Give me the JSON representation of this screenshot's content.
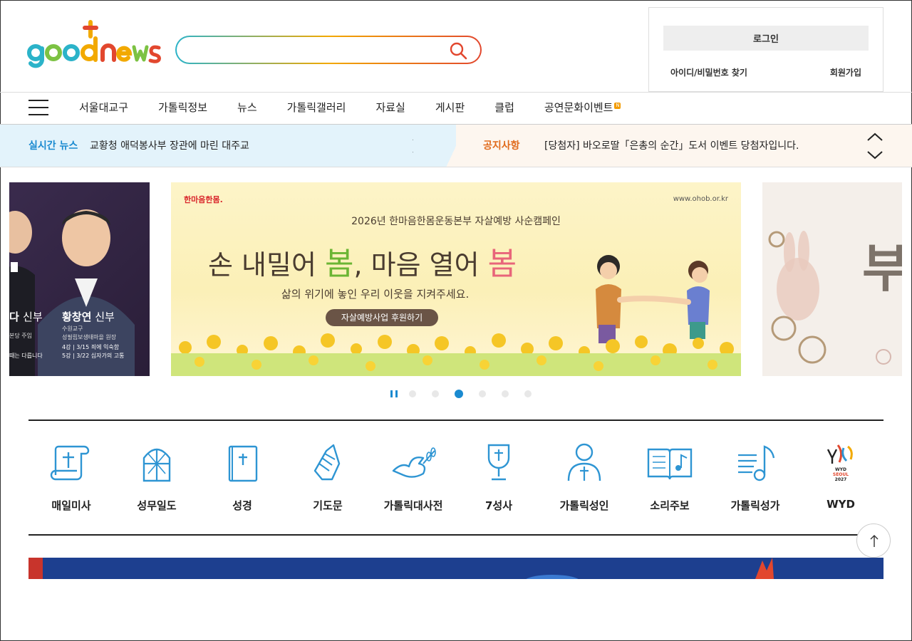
{
  "search": {
    "placeholder": ""
  },
  "account": {
    "login_label": "로그인",
    "find_label": "아이디/비밀번호 찾기",
    "join_label": "회원가입"
  },
  "nav": {
    "items": [
      "서울대교구",
      "가톨릭정보",
      "뉴스",
      "가톨릭갤러리",
      "자료실",
      "게시판",
      "클럽",
      "공연문화이벤트"
    ],
    "new_badge": "N"
  },
  "ticker": {
    "news_label": "실시간 뉴스",
    "news_text": "교황청 애덕봉사부 장관에 마린 대주교",
    "notice_label": "공지사항",
    "notice_text": "[당첨자] 바오로딸「은총의 순간」도서 이벤트 당첨자입니다."
  },
  "slides": {
    "left": {
      "name": "황창연",
      "title": "신부",
      "partial_name": "다",
      "desc1": "수원교구",
      "desc2": "성필립보생태마을 원장",
      "left_desc": "본당 주임",
      "lecture1": "4강 | 3/15  죄에 익숙함",
      "lecture2": "5강 | 3/22  십자가의 고통",
      "left_lecture": "때는 다릅니다"
    },
    "center": {
      "org": "한마음한몸.",
      "url": "www.ohob.or.kr",
      "subtitle": "2026년 한마음한몸운동본부 자살예방 사순캠페인",
      "headline_a": "손 내밀어 ",
      "headline_b": "봄",
      "headline_c": ", 마음 열어 ",
      "headline_d": "봄",
      "tagline": "삶의 위기에 놓인 우리 이웃을 지켜주세요.",
      "cta": "자살예방사업 후원하기"
    },
    "right": {
      "text": "부"
    }
  },
  "carousel": {
    "dot_count": 6,
    "active_index": 2
  },
  "quick_menu": [
    {
      "label": "매일미사",
      "icon": "scroll-cross-icon"
    },
    {
      "label": "성무일도",
      "icon": "stained-glass-icon"
    },
    {
      "label": "성경",
      "icon": "bible-icon"
    },
    {
      "label": "기도문",
      "icon": "praying-hands-icon"
    },
    {
      "label": "가톨릭대사전",
      "icon": "dove-icon"
    },
    {
      "label": "7성사",
      "icon": "chalice-icon"
    },
    {
      "label": "가톨릭성인",
      "icon": "saint-icon"
    },
    {
      "label": "소리주보",
      "icon": "open-book-music-icon"
    },
    {
      "label": "가톨릭성가",
      "icon": "music-note-icon"
    },
    {
      "label": "WYD",
      "icon": "wyd-logo-icon"
    }
  ],
  "wyd_logo": {
    "line1": "WYD",
    "line2": "SEOUL",
    "line3": "2027"
  },
  "colors": {
    "accent": "#1a8ad0",
    "notice": "#e06a1b",
    "icon": "#2e95d3"
  }
}
